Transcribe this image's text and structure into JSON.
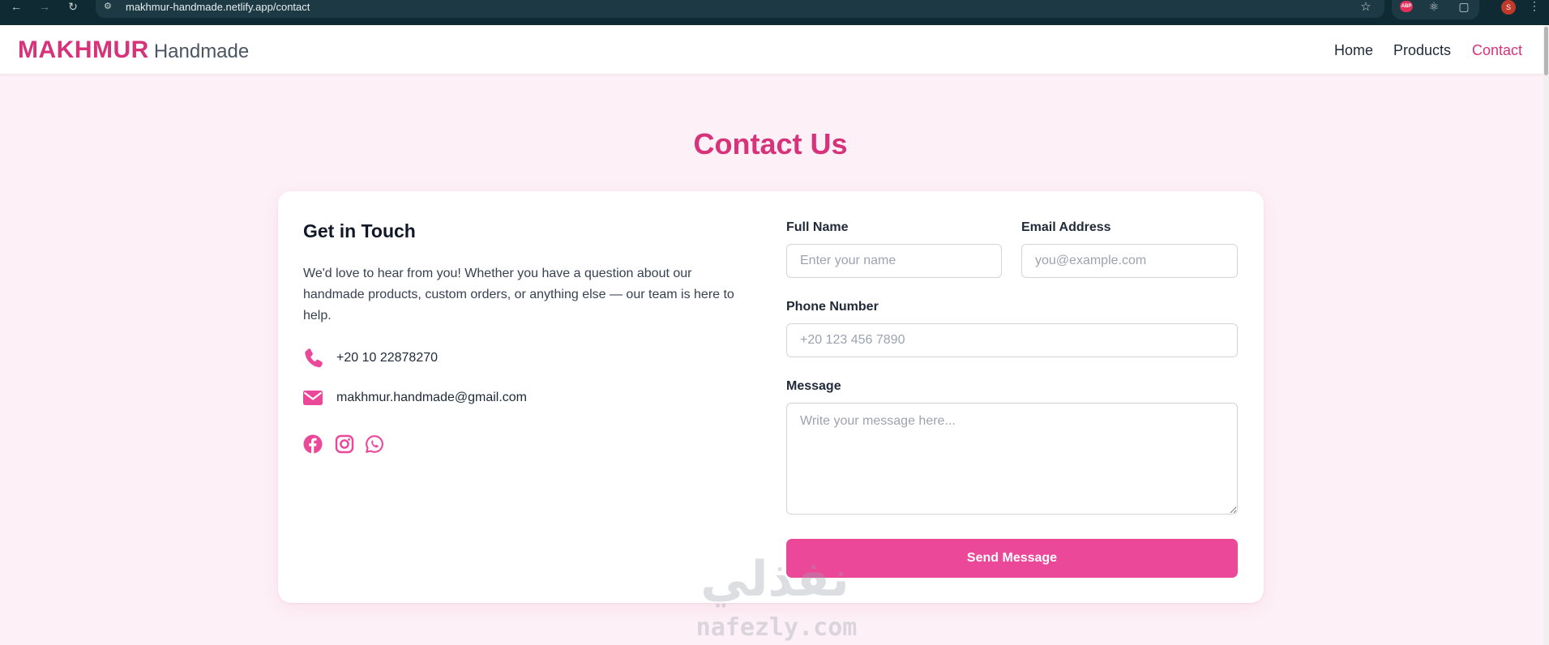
{
  "browser": {
    "url": "makhmur-handmade.netlify.app/contact",
    "abp_label": "ABP",
    "profile_initial": "S"
  },
  "header": {
    "brand_main": "MAKHMUR",
    "brand_sub": "Handmade",
    "nav": [
      {
        "label": "Home",
        "active": false
      },
      {
        "label": "Products",
        "active": false
      },
      {
        "label": "Contact",
        "active": true
      }
    ]
  },
  "page": {
    "title": "Contact Us"
  },
  "info": {
    "title": "Get in Touch",
    "description": "We'd love to hear from you! Whether you have a question about our handmade products, custom orders, or anything else — our team is here to help.",
    "phone": "+20 10 22878270",
    "email": "makhmur.handmade@gmail.com",
    "social": [
      "facebook-icon",
      "instagram-icon",
      "whatsapp-icon"
    ]
  },
  "form": {
    "full_name_label": "Full Name",
    "full_name_placeholder": "Enter your name",
    "email_label": "Email Address",
    "email_placeholder": "you@example.com",
    "phone_label": "Phone Number",
    "phone_placeholder": "+20 123 456 7890",
    "message_label": "Message",
    "message_placeholder": "Write your message here...",
    "submit_label": "Send Message"
  },
  "watermark": {
    "arabic": "نفذلي",
    "latin": "nafezly.com"
  },
  "colors": {
    "accent": "#d6337a",
    "button": "#ec4899",
    "page_bg": "#fdf0f6"
  }
}
